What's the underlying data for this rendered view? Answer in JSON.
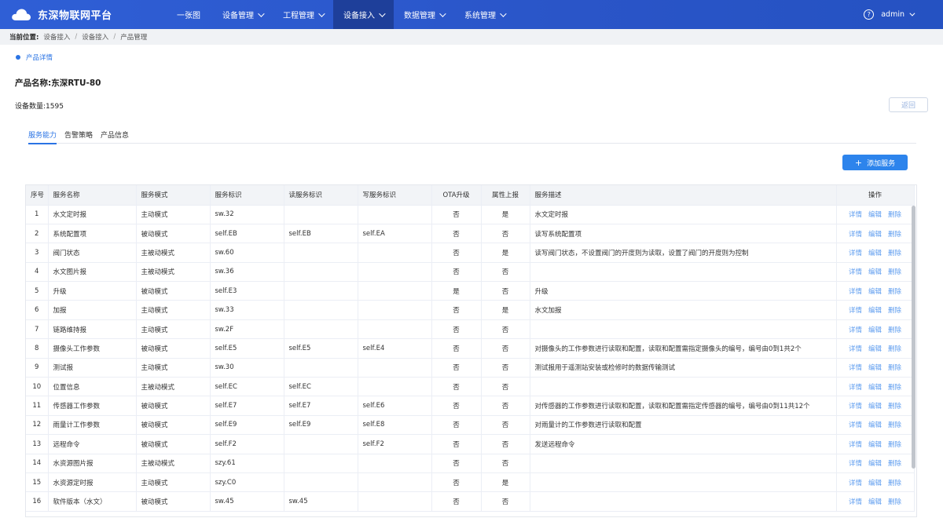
{
  "app": {
    "name": "东深物联网平台"
  },
  "nav": [
    {
      "label": "一张图",
      "dropdown": false,
      "active": false
    },
    {
      "label": "设备管理",
      "dropdown": true,
      "active": false
    },
    {
      "label": "工程管理",
      "dropdown": true,
      "active": false
    },
    {
      "label": "设备接入",
      "dropdown": true,
      "active": true
    },
    {
      "label": "数据管理",
      "dropdown": true,
      "active": false
    },
    {
      "label": "系统管理",
      "dropdown": true,
      "active": false
    }
  ],
  "user": {
    "name": "admin",
    "help_glyph": "?"
  },
  "breadcrumb": {
    "label": "当前位置:",
    "items": [
      "设备接入",
      "设备接入",
      "产品管理"
    ]
  },
  "section": {
    "title": "产品详情"
  },
  "product": {
    "name": "产品名称:东深RTU-80",
    "device_count": "设备数量:1595"
  },
  "back_label": "返回",
  "tabs": [
    "服务能力",
    "告警策略",
    "产品信息"
  ],
  "add_label": "添加服务",
  "add_glyph": "+",
  "table": {
    "headers": [
      "序号",
      "服务名称",
      "服务模式",
      "服务标识",
      "读服务标识",
      "写服务标识",
      "OTA升级",
      "属性上报",
      "服务描述",
      "操作"
    ],
    "ops": [
      "详情",
      "编辑",
      "删除"
    ],
    "rows": [
      [
        "1",
        "水文定时报",
        "主动模式",
        "sw.32",
        "",
        "",
        "否",
        "是",
        "水文定时报"
      ],
      [
        "2",
        "系统配置项",
        "被动模式",
        "self.EB",
        "self.EB",
        "self.EA",
        "否",
        "否",
        "读写系统配置项"
      ],
      [
        "3",
        "阀门状态",
        "主被动模式",
        "sw.60",
        "",
        "",
        "否",
        "是",
        "读写阀门状态，不设置阀门的开度则为读取，设置了阀门的开度则为控制"
      ],
      [
        "4",
        "水文图片报",
        "主被动模式",
        "sw.36",
        "",
        "",
        "否",
        "否",
        ""
      ],
      [
        "5",
        "升级",
        "被动模式",
        "self.E3",
        "",
        "",
        "是",
        "否",
        "升级"
      ],
      [
        "6",
        "加报",
        "主动模式",
        "sw.33",
        "",
        "",
        "否",
        "是",
        "水文加报"
      ],
      [
        "7",
        "链路维持报",
        "主动模式",
        "sw.2F",
        "",
        "",
        "否",
        "否",
        ""
      ],
      [
        "8",
        "摄像头工作参数",
        "被动模式",
        "self.E5",
        "self.E5",
        "self.E4",
        "否",
        "否",
        "对摄像头的工作参数进行读取和配置，读取和配置需指定摄像头的编号，编号由0到1共2个"
      ],
      [
        "9",
        "测试报",
        "主动模式",
        "sw.30",
        "",
        "",
        "否",
        "否",
        "测试报用于遥测站安装或检修时的数据传输测试"
      ],
      [
        "10",
        "位置信息",
        "主被动模式",
        "self.EC",
        "self.EC",
        "",
        "否",
        "否",
        ""
      ],
      [
        "11",
        "传感器工作参数",
        "被动模式",
        "self.E7",
        "self.E7",
        "self.E6",
        "否",
        "否",
        "对传感器的工作参数进行读取和配置，读取和配置需指定传感器的编号，编号由0到11共12个"
      ],
      [
        "12",
        "雨量计工作参数",
        "被动模式",
        "self.E9",
        "self.E9",
        "self.E8",
        "否",
        "否",
        "对雨量计的工作参数进行读取和配置"
      ],
      [
        "13",
        "远程命令",
        "被动模式",
        "self.F2",
        "",
        "self.F2",
        "否",
        "否",
        "发送远程命令"
      ],
      [
        "14",
        "水资源图片报",
        "主被动模式",
        "szy.61",
        "",
        "",
        "否",
        "否",
        ""
      ],
      [
        "15",
        "水资源定时报",
        "主动模式",
        "szy.C0",
        "",
        "",
        "否",
        "是",
        ""
      ],
      [
        "16",
        "软件版本（水文）",
        "被动模式",
        "sw.45",
        "sw.45",
        "",
        "否",
        "否",
        ""
      ]
    ]
  }
}
